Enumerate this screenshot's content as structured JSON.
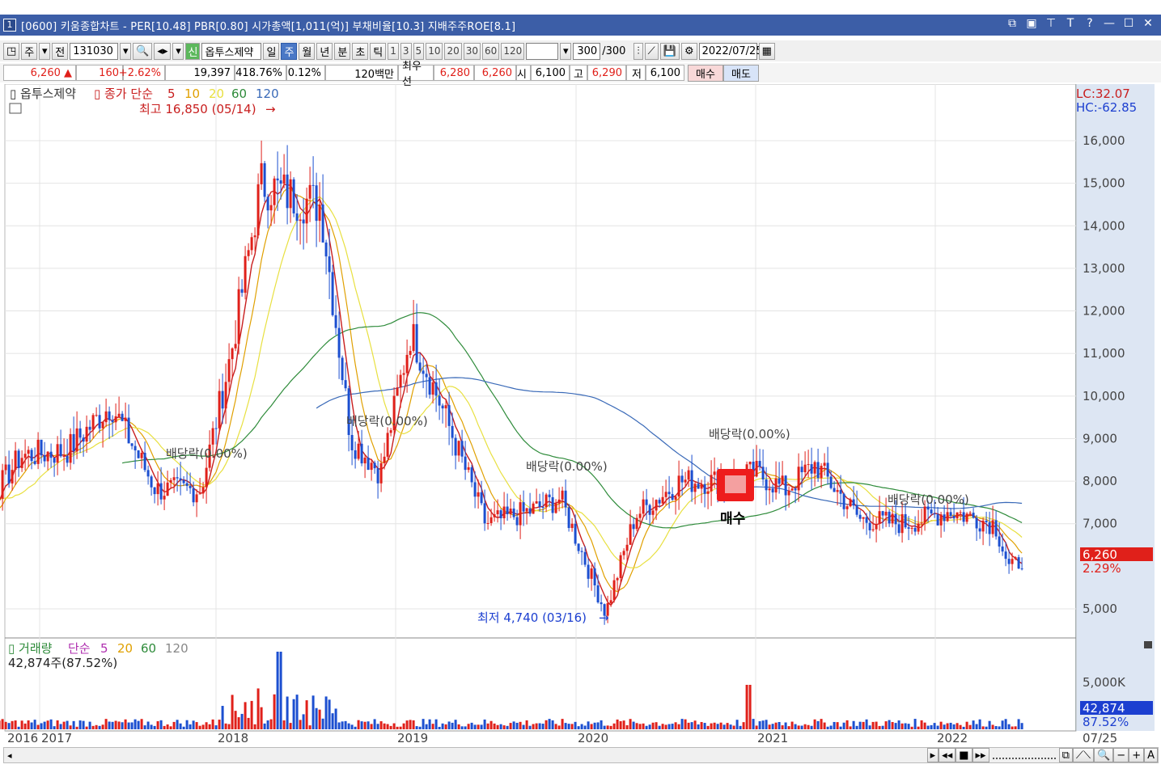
{
  "window": {
    "number": "1",
    "title": "[0600] 키움종합차트 - PER[10.48] PBR[0.80] 시가총액[1,011(억)] 부채비율[10.3] 지배주주ROE[8.1]"
  },
  "toolbar": {
    "mode": "주",
    "prev": "전",
    "code": "131030",
    "badge": "신",
    "stock_name": "옵투스제약",
    "periods": [
      "일",
      "주",
      "월",
      "년",
      "분",
      "초",
      "틱"
    ],
    "selected_period": "주",
    "intervals": [
      "1",
      "3",
      "5",
      "10",
      "20",
      "30",
      "60",
      "120"
    ],
    "count": "300",
    "count_total": "/300",
    "date": "2022/07/25"
  },
  "quote": {
    "price": "6,260",
    "arrow": "▲",
    "change": "160",
    "change_pct": "+2.62%",
    "volume": "19,397",
    "vol_ratio": "418.76%",
    "turnover": "0.12%",
    "amount_label": "120백만",
    "best_label": "최우선",
    "ask": "6,280",
    "bid": "6,260",
    "open_label": "시",
    "open": "6,100",
    "high_label": "고",
    "high": "6,290",
    "low_label": "저",
    "low": "6,100",
    "buy": "매수",
    "sell": "매도"
  },
  "chart_legend": {
    "name": "옵투스제약",
    "series": "종가 단순",
    "ma": [
      "5",
      "10",
      "20",
      "60",
      "120"
    ],
    "ma_colors": [
      "#c81e1e",
      "#e0a000",
      "#e8e040",
      "#2e8b3a",
      "#3a6ab8"
    ],
    "high_note": "최고 16,850 (05/14)",
    "low_note": "최저 4,740 (03/16)",
    "lc": "LC:32.07",
    "hc": "HC:-62.85",
    "buy_marker": "매수",
    "last_price": "6,260",
    "last_pct": "2.29%"
  },
  "dividend_notes": [
    "배당락(0.00%)",
    "배당락(0.00%)",
    "배당락(0.00%)",
    "배당락(0.00%)",
    "배당락(0.00%)"
  ],
  "volume_legend": {
    "name": "거래량",
    "series": "단순",
    "ma": [
      "5",
      "20",
      "60",
      "120"
    ],
    "value": "42,874주(87.52%)",
    "axis_label": "5,000K",
    "last_value": "42,874",
    "last_pct": "87.52%"
  },
  "chart_data": {
    "type": "candlestick",
    "title": "옵투스제약",
    "y_ticks": [
      "16,000",
      "15,000",
      "14,000",
      "13,000",
      "12,000",
      "11,000",
      "10,000",
      "9,000",
      "8,000",
      "7,000",
      "5,000"
    ],
    "x_ticks": [
      "2016",
      "2017",
      "2018",
      "2019",
      "2020",
      "2021",
      "2022",
      "07/25"
    ],
    "ylim": [
      4700,
      17000
    ],
    "close_path": [
      [
        "2016-06",
        8500
      ],
      [
        "2016-09",
        7100
      ],
      [
        "2016-12",
        8600
      ],
      [
        "2017-03",
        8700
      ],
      [
        "2017-06",
        9800
      ],
      [
        "2017-09",
        7800
      ],
      [
        "2017-12",
        7800
      ],
      [
        "2018-02",
        11000
      ],
      [
        "2018-04",
        15000
      ],
      [
        "2018-06",
        14700
      ],
      [
        "2018-08",
        14500
      ],
      [
        "2018-10",
        9000
      ],
      [
        "2018-12",
        8200
      ],
      [
        "2019-02",
        11500
      ],
      [
        "2019-04",
        9800
      ],
      [
        "2019-07",
        7000
      ],
      [
        "2019-10",
        7300
      ],
      [
        "2019-12",
        7600
      ],
      [
        "2020-03",
        4900
      ],
      [
        "2020-05",
        7200
      ],
      [
        "2020-08",
        8000
      ],
      [
        "2020-11",
        8000
      ],
      [
        "2021-01",
        8200
      ],
      [
        "2021-03",
        7800
      ],
      [
        "2021-05",
        8400
      ],
      [
        "2021-08",
        7100
      ],
      [
        "2021-11",
        7000
      ],
      [
        "2022-02",
        7300
      ],
      [
        "2022-05",
        7000
      ],
      [
        "2022-06",
        5900
      ],
      [
        "2022-07",
        6260
      ]
    ]
  }
}
